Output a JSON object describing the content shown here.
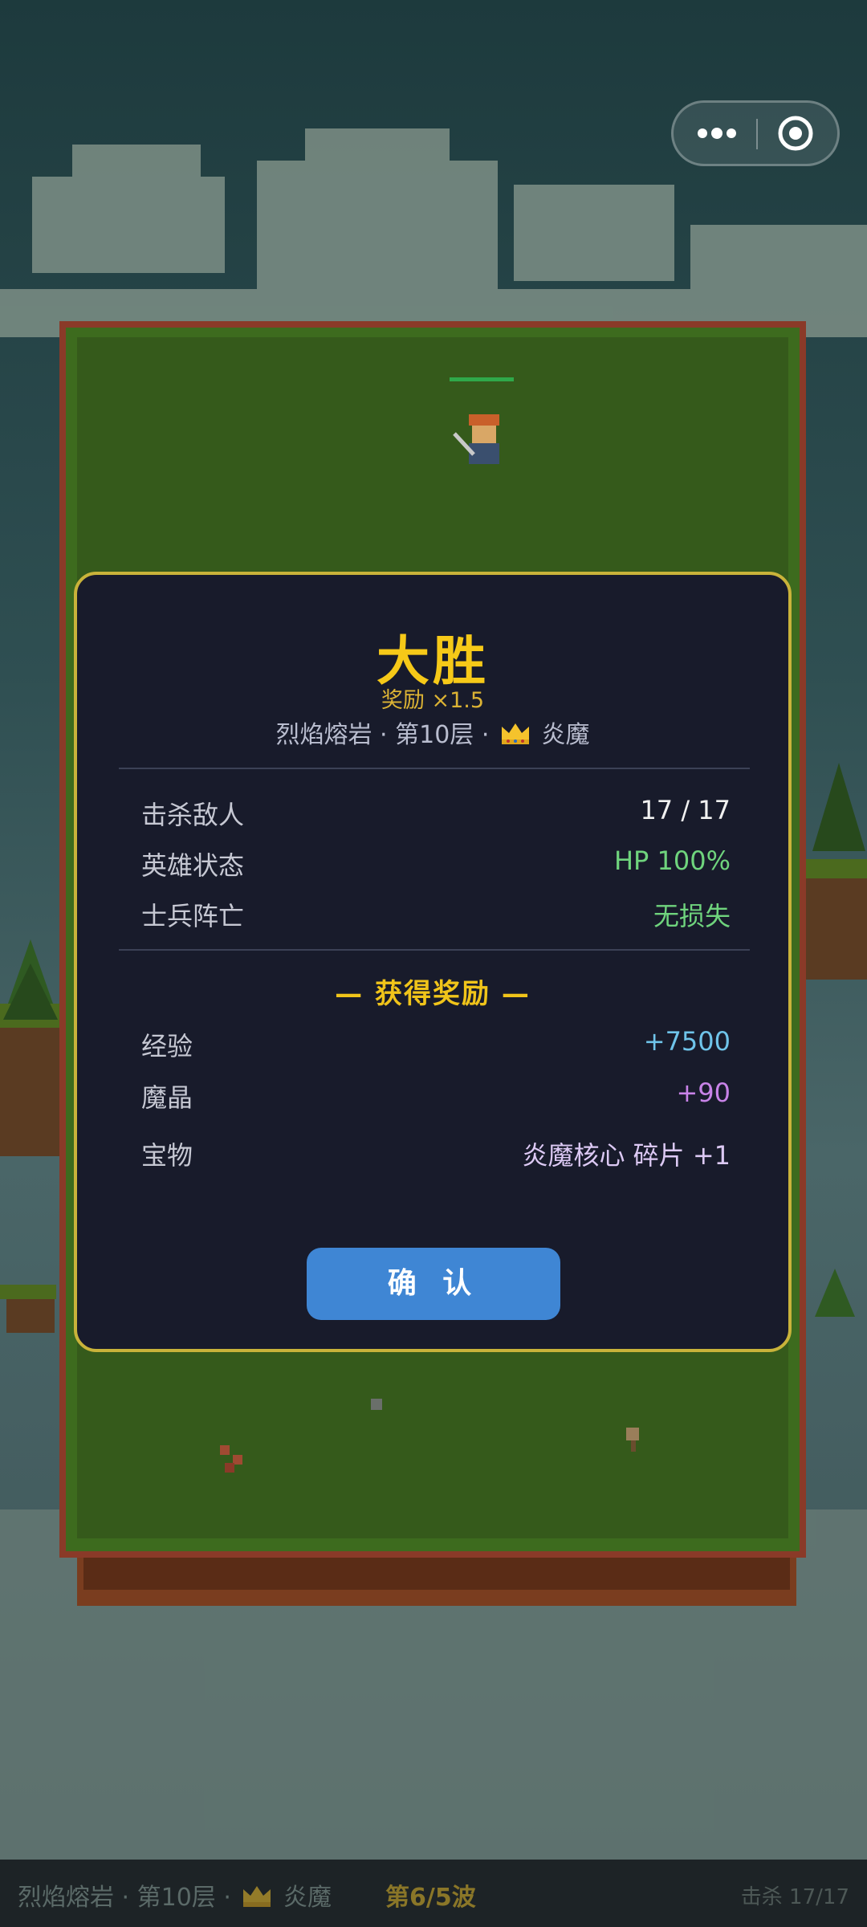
{
  "top_capsule": {
    "more_icon": "more-dots-icon",
    "close_icon": "target-circle-icon"
  },
  "result": {
    "title": "大胜",
    "reward_multiplier": "奖励 ×1.5",
    "location": "烈焰熔岩 · 第10层 ·",
    "boss_icon": "crown-icon",
    "boss_name": "炎魔"
  },
  "stats": [
    {
      "label": "击杀敌人",
      "value": "17 / 17",
      "color": "#f1f1f1"
    },
    {
      "label": "英雄状态",
      "value": "HP 100%",
      "color": "#6fd47d"
    },
    {
      "label": "士兵阵亡",
      "value": "无损失",
      "color": "#6fd47d"
    }
  ],
  "rewards_title": "— 获得奖励 —",
  "rewards": [
    {
      "label": "经验",
      "value": "+7500",
      "color": "#6fc4ea"
    },
    {
      "label": "魔晶",
      "value": "+90",
      "color": "#c883e8"
    },
    {
      "label": "宝物",
      "value": "炎魔核心 碎片 +1",
      "color": "#dcc9f4"
    }
  ],
  "confirm_label": "确 认",
  "bottom_bar": {
    "location": "烈焰熔岩 · 第10层 ·",
    "boss_name": "炎魔",
    "wave": "第6/5波",
    "kills": "击杀 17/17"
  },
  "colors": {
    "accent_gold": "#f6c918",
    "modal_bg": "#181b2b",
    "modal_border": "#c9b33a",
    "button": "#3f86d4",
    "grass": "#355a1b"
  }
}
